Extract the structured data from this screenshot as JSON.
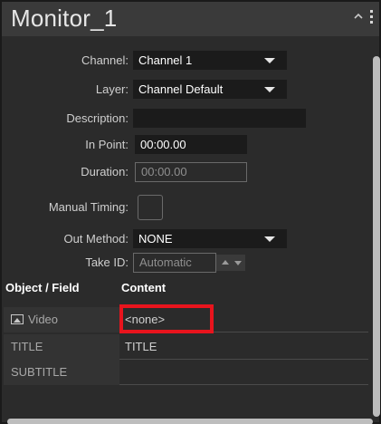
{
  "header": {
    "title": "Monitor_1"
  },
  "form": {
    "channel": {
      "label": "Channel:",
      "value": "Channel 1"
    },
    "layer": {
      "label": "Layer:",
      "value": "Channel Default"
    },
    "description": {
      "label": "Description:",
      "value": ""
    },
    "in_point": {
      "label": "In Point:",
      "value": "00:00.00"
    },
    "duration": {
      "label": "Duration:",
      "value": "00:00.00"
    },
    "manual_timing": {
      "label": "Manual Timing:",
      "checked": false
    },
    "out_method": {
      "label": "Out Method:",
      "value": "NONE"
    },
    "take_id": {
      "label": "Take ID:",
      "placeholder": "Automatic"
    }
  },
  "table": {
    "headers": {
      "field": "Object / Field",
      "content": "Content"
    },
    "rows": [
      {
        "field": "Video",
        "content": "<none>",
        "icon": "image-icon"
      },
      {
        "field": "TITLE",
        "content": "TITLE"
      },
      {
        "field": "SUBTITLE",
        "content": ""
      }
    ]
  },
  "colors": {
    "panel_bg": "#2b2b2b",
    "field_bg": "#1b1b1b",
    "highlight": "#e8141d"
  }
}
